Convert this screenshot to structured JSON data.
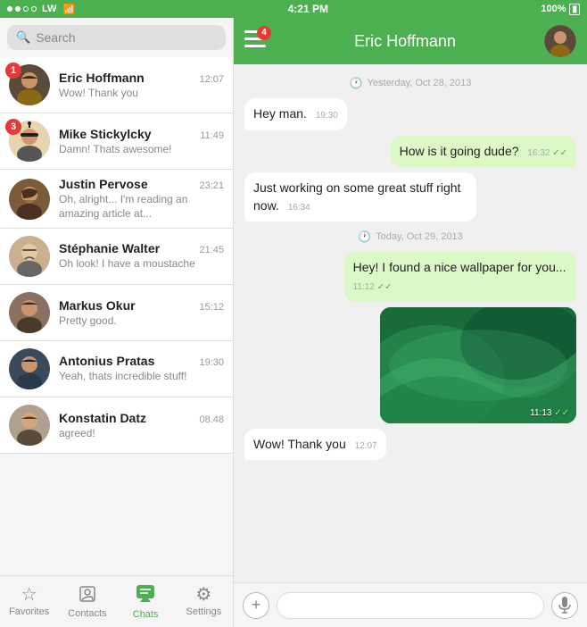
{
  "statusBar": {
    "signal": "●●○○ LW",
    "wifi": "wifi",
    "time": "4:21 PM",
    "battery": "100%"
  },
  "search": {
    "placeholder": "Search"
  },
  "chats": [
    {
      "id": "eric",
      "name": "Eric Hoffmann",
      "time": "12:07",
      "preview": "Wow! Thank you",
      "badge": "1",
      "hasBadge": true
    },
    {
      "id": "mike",
      "name": "Mike Stickylcky",
      "time": "11:49",
      "preview": "Damn! Thats awesome!",
      "badge": "3",
      "hasBadge": true
    },
    {
      "id": "justin",
      "name": "Justin Pervose",
      "time": "23:21",
      "preview": "Oh, alright... I'm reading an amazing article at...",
      "hasBadge": false
    },
    {
      "id": "stephanie",
      "name": "Stéphanie Walter",
      "time": "21:45",
      "preview": "Oh look! I have a moustache",
      "hasBadge": false
    },
    {
      "id": "markus",
      "name": "Markus Okur",
      "time": "15:12",
      "preview": "Pretty good.",
      "hasBadge": false
    },
    {
      "id": "antonius",
      "name": "Antonius Pratas",
      "time": "19:30",
      "preview": "Yeah, thats incredible stuff!",
      "hasBadge": false
    },
    {
      "id": "konstatin",
      "name": "Konstatin Datz",
      "time": "08.48",
      "preview": "agreed!",
      "hasBadge": false
    }
  ],
  "tabBar": {
    "items": [
      {
        "id": "favorites",
        "label": "Favorites",
        "icon": "☆"
      },
      {
        "id": "contacts",
        "label": "Contacts",
        "icon": "👤"
      },
      {
        "id": "chats",
        "label": "Chats",
        "icon": "💬",
        "active": true
      },
      {
        "id": "settings",
        "label": "Settings",
        "icon": "⚙"
      }
    ]
  },
  "chatHeader": {
    "title": "Eric Hoffmann",
    "badge": "4"
  },
  "messages": [
    {
      "type": "date",
      "text": "Yesterday, Oct 28, 2013"
    },
    {
      "type": "incoming",
      "text": "Hey man.",
      "time": "19:30"
    },
    {
      "type": "outgoing",
      "text": "How is it going dude?",
      "time": "16:32",
      "ticks": true
    },
    {
      "type": "incoming",
      "text": "Just working on some great stuff right now.",
      "time": "16:34"
    },
    {
      "type": "date",
      "text": "Today, Oct 29, 2013"
    },
    {
      "type": "outgoing",
      "text": "Hey! I found a nice wallpaper for you...",
      "time": "11:12",
      "ticks": true
    },
    {
      "type": "image",
      "time": "11:13",
      "ticks": true
    },
    {
      "type": "incoming",
      "text": "Wow! Thank you",
      "time": "12:07"
    }
  ],
  "inputBar": {
    "placeholder": ""
  }
}
